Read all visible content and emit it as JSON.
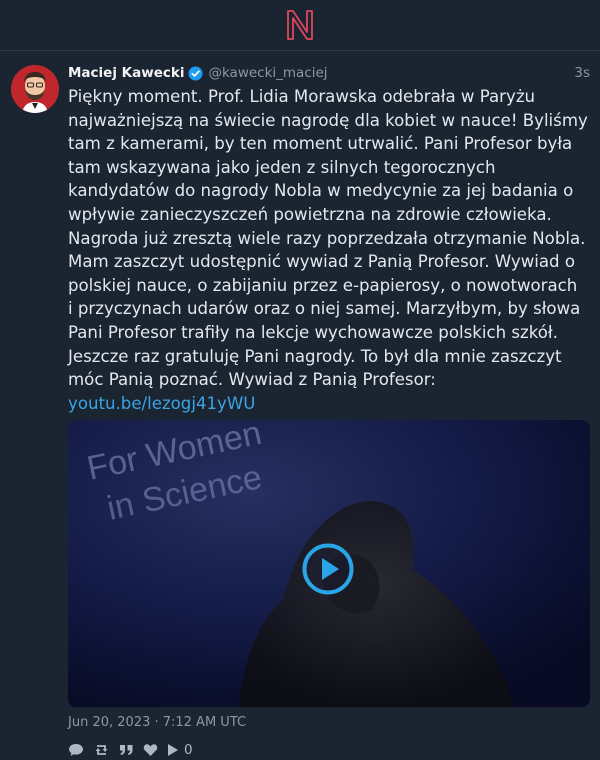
{
  "app": {
    "logo_icon": "n-logo-icon"
  },
  "post": {
    "author_name": "Maciej Kawecki",
    "handle": "@kawecki_maciej",
    "time_ago": "3s",
    "text": "Piękny moment. Prof. Lidia Morawska odebrała w Paryżu\nnajważniejszą na świecie nagrodę dla kobiet w nauce! Byliśmy\ntam z kamerami, by ten moment utrwalić. Pani Profesor była\ntam wskazywana jako jeden z silnych tegorocznych\nkandydatów do nagrody Nobla w medycynie za jej badania o\nwpływie zanieczyszczeń powietrzna na zdrowie człowieka.\nNagroda już zresztą wiele razy poprzedzała otrzymanie Nobla.\nMam zaszczyt udostępnić wywiad z Panią Profesor. Wywiad o\npolskiej nauce, o zabijaniu przez e-papierosy, o nowotworach\ni przyczynach udarów oraz o niej samej. Marzyłbym, by słowa\nPani Profesor trafiły na lekcje wychowawcze polskich szkół.\nJeszcze raz gratuluję Pani nagrody. To był dla mnie zaszczyt\nmóc Panią poznać. Wywiad z Panią Profesor:",
    "link": "youtu.be/lezogj41yWU",
    "media": {
      "backdrop_text_1": "For Women",
      "backdrop_text_2": "in Science"
    },
    "timestamp": "Jun 20, 2023 · 7:12 AM UTC",
    "actions": {
      "reply_icon": "comment-icon",
      "repost_icon": "retweet-icon",
      "quote_icon": "quote-icon",
      "like_icon": "heart-icon",
      "views_icon": "play-icon",
      "views_count": "0"
    }
  },
  "colors": {
    "background": "#1b2431",
    "accent_logo": "#e0465c",
    "link": "#3ba4e5",
    "verified": "#1d9bf0"
  }
}
